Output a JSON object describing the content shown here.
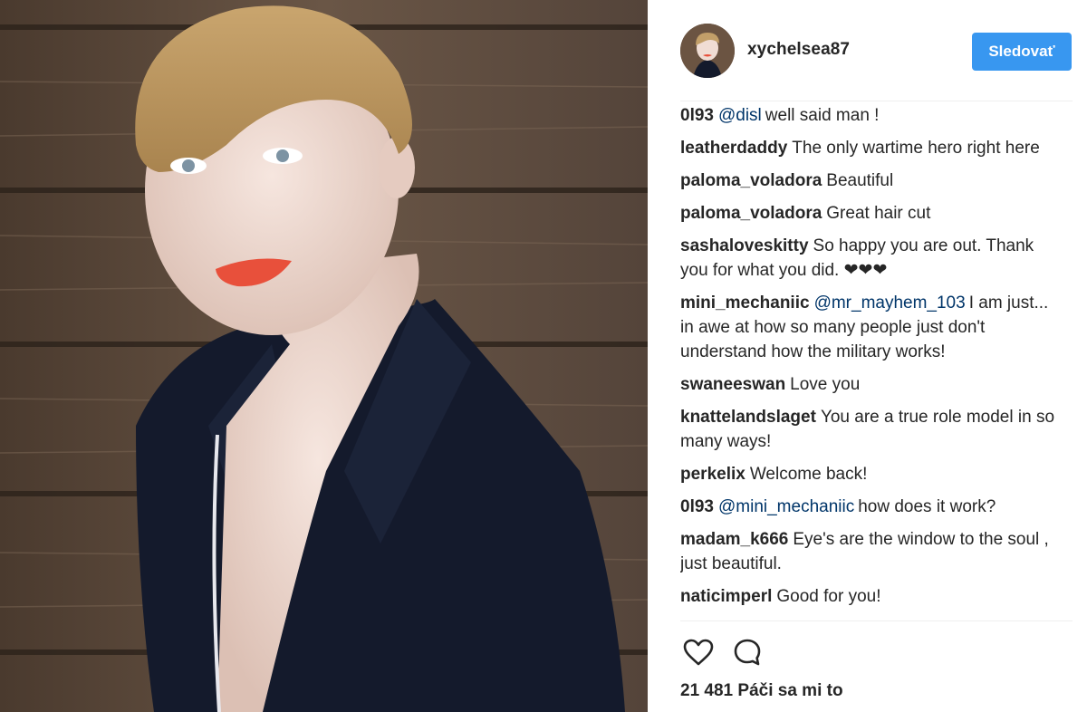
{
  "header": {
    "username": "xychelsea87",
    "follow_label": "Sledovať"
  },
  "comments": [
    {
      "user": "0l93",
      "mention": "@disl",
      "text": "well said man !"
    },
    {
      "user": "leatherdaddy",
      "mention": "",
      "text": "The only wartime hero right here"
    },
    {
      "user": "paloma_voladora",
      "mention": "",
      "text": "Beautiful"
    },
    {
      "user": "paloma_voladora",
      "mention": "",
      "text": "Great hair cut"
    },
    {
      "user": "sashaloveskitty",
      "mention": "",
      "text": "So happy you are out. Thank you for what you did. ❤❤❤"
    },
    {
      "user": "mini_mechaniic",
      "mention": "@mr_mayhem_103",
      "text": "I am just... in awe at how so many people just don't understand how the military works!"
    },
    {
      "user": "swaneeswan",
      "mention": "",
      "text": "Love you"
    },
    {
      "user": "knattelandslaget",
      "mention": "",
      "text": "You are a true role model in so many ways!"
    },
    {
      "user": "perkelix",
      "mention": "",
      "text": "Welcome back!"
    },
    {
      "user": "0l93",
      "mention": "@mini_mechaniic",
      "text": "how does it work?"
    },
    {
      "user": "madam_k666",
      "mention": "",
      "text": "Eye's are the window to the soul , just beautiful."
    },
    {
      "user": "naticimperl",
      "mention": "",
      "text": "Good for you!"
    }
  ],
  "actions": {
    "like_icon": "heart-outline-icon",
    "comment_icon": "speech-bubble-icon"
  },
  "likes": {
    "label": "21 481 Páči sa mi to"
  },
  "colors": {
    "follow_button": "#3897f0",
    "mention": "#003569",
    "text": "#262626",
    "divider": "#efefef"
  }
}
